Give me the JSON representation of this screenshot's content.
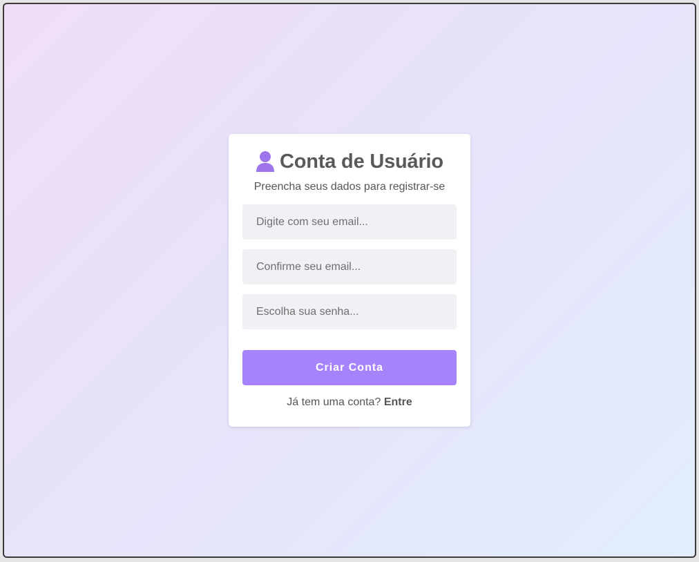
{
  "card": {
    "icon": "user-icon",
    "title": "Conta de Usuário",
    "subtitle": "Preencha seus dados para registrar-se"
  },
  "form": {
    "email_placeholder": "Digite com seu email...",
    "email_value": "",
    "confirm_email_placeholder": "Confirme seu email...",
    "confirm_email_value": "",
    "password_placeholder": "Escolha sua senha...",
    "password_value": "",
    "submit_label": "Criar Conta"
  },
  "footer": {
    "prompt": "Já tem uma conta?",
    "link_label": "Entre"
  },
  "colors": {
    "accent": "#a683fb",
    "icon": "#9d74ea",
    "title": "#595959",
    "field_bg": "#f0f1f5"
  }
}
